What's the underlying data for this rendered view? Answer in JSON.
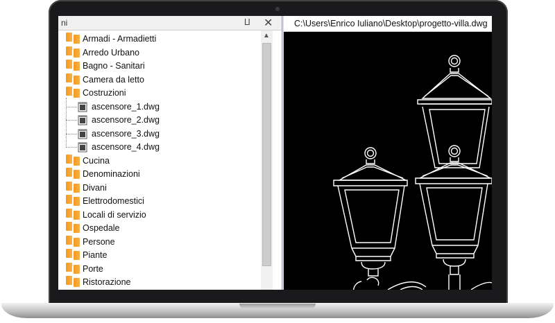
{
  "panel": {
    "title": "ni",
    "pin_icon": "pin-icon",
    "close_icon": "close-icon"
  },
  "tree": {
    "items": [
      {
        "label": "Armadi - Armadietti",
        "type": "folder"
      },
      {
        "label": "Arredo Urbano",
        "type": "folder"
      },
      {
        "label": "Bagno - Sanitari",
        "type": "folder"
      },
      {
        "label": "Camera da letto",
        "type": "folder"
      },
      {
        "label": "Costruzioni",
        "type": "folder"
      },
      {
        "label": "ascensore_1.dwg",
        "type": "file"
      },
      {
        "label": "ascensore_2.dwg",
        "type": "file"
      },
      {
        "label": "ascensore_3.dwg",
        "type": "file"
      },
      {
        "label": "ascensore_4.dwg",
        "type": "file"
      },
      {
        "label": "Cucina",
        "type": "folder"
      },
      {
        "label": "Denominazioni",
        "type": "folder"
      },
      {
        "label": "Divani",
        "type": "folder"
      },
      {
        "label": "Elettrodomestici",
        "type": "folder"
      },
      {
        "label": "Locali di servizio",
        "type": "folder"
      },
      {
        "label": "Ospedale",
        "type": "folder"
      },
      {
        "label": "Persone",
        "type": "folder"
      },
      {
        "label": "Piante",
        "type": "folder"
      },
      {
        "label": "Porte",
        "type": "folder"
      },
      {
        "label": "Ristorazione",
        "type": "folder"
      }
    ]
  },
  "view": {
    "path": "C:\\Users\\Enrico Iuliano\\Desktop\\progetto-villa.dwg"
  },
  "colors": {
    "folder": "#f59a21",
    "canvas": "#000000",
    "lines": "#ffffff"
  }
}
